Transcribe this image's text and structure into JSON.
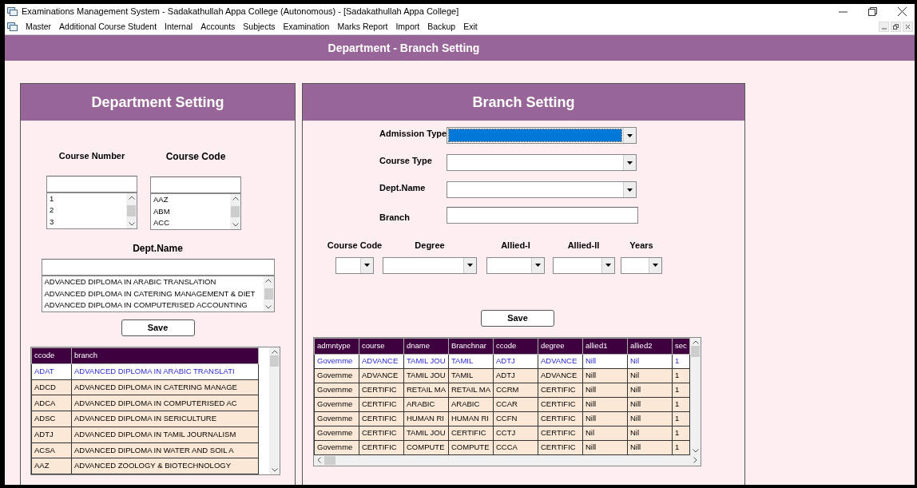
{
  "window": {
    "title": "Examinations Management System - Sadakathullah Appa College (Autonomous) - [Sadakathullah Appa College]"
  },
  "menu": [
    "Master",
    "Additional Course Student",
    "Internal",
    "Accounts",
    "Subjects",
    "Examination",
    "Marks Report",
    "Import",
    "Backup",
    "Exit"
  ],
  "header": {
    "title": "Department - Branch Setting"
  },
  "department_panel": {
    "title": "Department Setting",
    "lists": [
      {
        "label": "Course Number",
        "items": [
          "1",
          "2",
          "3"
        ]
      },
      {
        "label": "Course Code",
        "items": [
          "AAZ",
          "ABM",
          "ACC"
        ]
      }
    ],
    "dept_name": {
      "label": "Dept.Name",
      "items": [
        "ADVANCED DIPLOMA IN ARABIC TRANSLATION",
        "ADVANCED DIPLOMA IN CATERING MANAGEMENT & DIET",
        "ADVANCED DIPLOMA IN COMPUTERISED ACCOUNTING"
      ]
    },
    "save_button": "Save",
    "table": {
      "columns": [
        "ccode",
        "branch"
      ],
      "rows": [
        {
          "cells": [
            "ADAT",
            "ADVANCED DIPLOMA IN ARABIC TRANSLATI"
          ],
          "selected": true
        },
        {
          "cells": [
            "ADCD",
            "ADVANCED DIPLOMA IN CATERING MANAGE"
          ],
          "selected": false
        },
        {
          "cells": [
            "ADCA",
            "ADVANCED DIPLOMA IN COMPUTERISED AC"
          ],
          "selected": false
        },
        {
          "cells": [
            "ADSC",
            "ADVANCED DIPLOMA IN SERICULTURE"
          ],
          "selected": false
        },
        {
          "cells": [
            "ADTJ",
            "ADVANCED DIPLOMA IN TAMIL JOURNALISM"
          ],
          "selected": false
        },
        {
          "cells": [
            "ACSA",
            "ADVANCED DIPLOMA IN WATER AND SOIL A"
          ],
          "selected": false
        },
        {
          "cells": [
            "AAZ",
            "ADVANCED ZOOLOGY & BIOTECHNOLOGY"
          ],
          "selected": false
        }
      ]
    }
  },
  "branch_panel": {
    "title": "Branch Setting",
    "dropdowns": [
      {
        "label": "Admission Type",
        "focused": true
      },
      {
        "label": "Course Type",
        "focused": false
      },
      {
        "label": "Dept.Name",
        "focused": false
      }
    ],
    "branch_field": {
      "label": "Branch"
    },
    "small_dropdowns": [
      {
        "label": "Course Code"
      },
      {
        "label": "Degree"
      },
      {
        "label": "Allied-I"
      },
      {
        "label": "Allied-II"
      },
      {
        "label": "Years"
      }
    ],
    "save_button": "Save",
    "table": {
      "columns": [
        "admntype",
        "course",
        "dname",
        "Branchnar",
        "ccode",
        "degree",
        "allied1",
        "allied2",
        "sec"
      ],
      "rows": [
        {
          "cells": [
            "Governme",
            "ADVANCE",
            "TAMIL JOU",
            "TAMIL",
            "ADTJ",
            "ADVANCE",
            "Nill",
            "Nil",
            "1"
          ],
          "selected": true
        },
        {
          "cells": [
            "Governme",
            "ADVANCE",
            "TAMIL JOU",
            "TAMIL",
            "ADTJ",
            "ADVANCE",
            "Nill",
            "Nil",
            "1"
          ],
          "selected": false
        },
        {
          "cells": [
            "Governme",
            "CERTIFIC",
            "RETAIL MA",
            "RETAIL MA",
            "CCRM",
            "CERTIFIC",
            "Nill",
            "Nill",
            "1"
          ],
          "selected": false
        },
        {
          "cells": [
            "Governme",
            "CERTIFIC",
            "ARABIC",
            "ARABIC",
            "CCAR",
            "CERTIFIC",
            "Nill",
            "Nill",
            "1"
          ],
          "selected": false
        },
        {
          "cells": [
            "Governme",
            "CERTIFIC",
            "HUMAN RI",
            "HUMAN RI",
            "CCFN",
            "CERTIFIC",
            "Nill",
            "Nill",
            "1"
          ],
          "selected": false
        },
        {
          "cells": [
            "Governme",
            "CERTIFIC",
            "TAMIL JOU",
            "CERTIFIC",
            "CCTJ",
            "CERTIFIC",
            "Nil",
            "Nil",
            "1"
          ],
          "selected": false
        },
        {
          "cells": [
            "Governme",
            "CERTIFIC",
            "COMPUTE",
            "COMPUTE",
            "CCCA",
            "CERTIFIC",
            "Nill",
            "Nill",
            "1"
          ],
          "selected": false
        }
      ]
    }
  }
}
